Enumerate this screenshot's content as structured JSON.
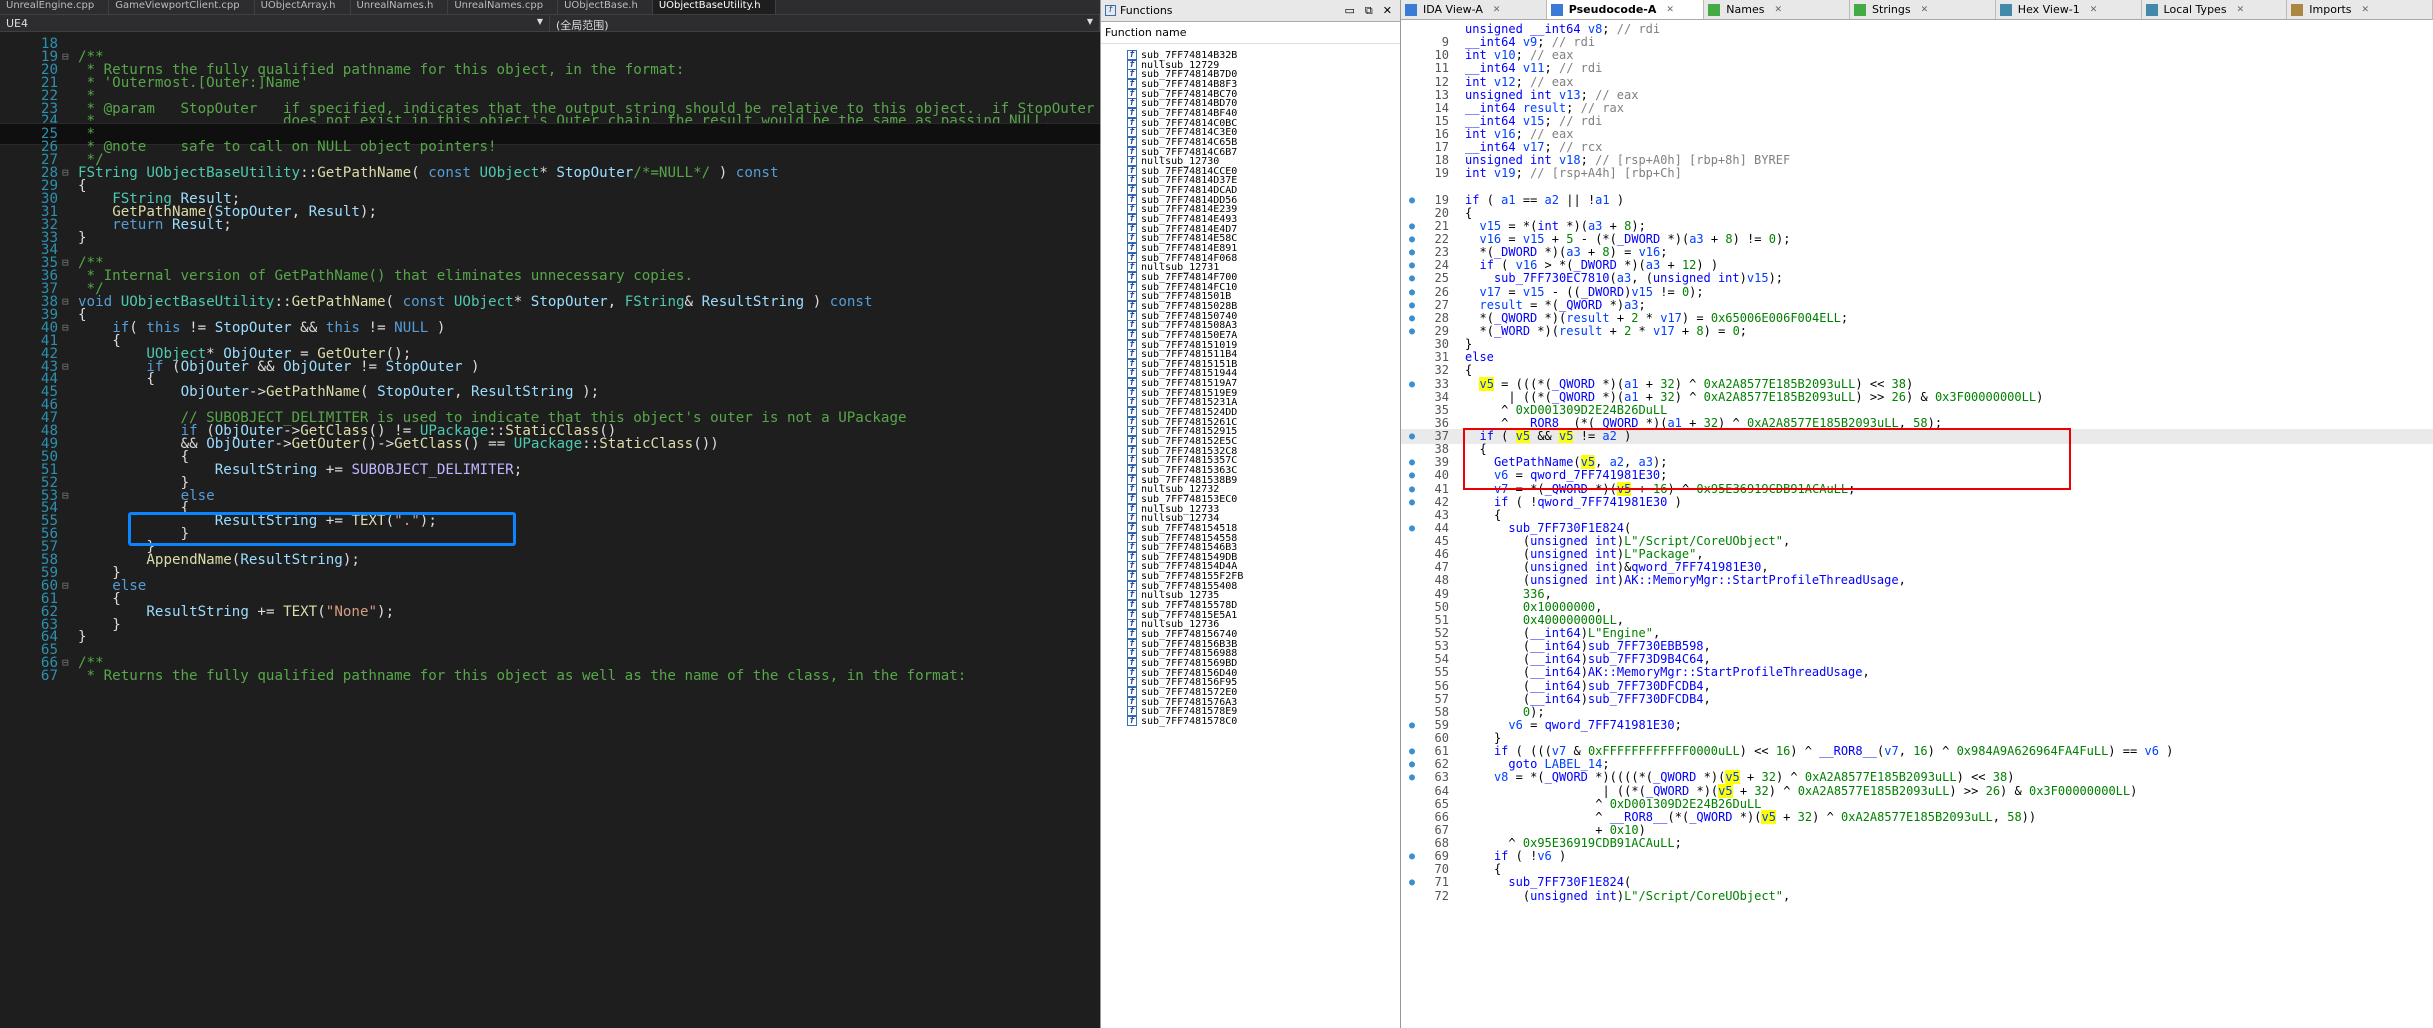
{
  "vs": {
    "tabs": [
      "UnrealEngine.cpp",
      "GameViewportClient.cpp",
      "UObjectArray.h",
      "UnrealNames.h",
      "UnrealNames.cpp",
      "UObjectBase.h",
      "UObjectBaseUtility.h"
    ],
    "nav_left": "UE4",
    "nav_right": "(全局范围)",
    "lines": [
      {
        "n": "18",
        "t": ""
      },
      {
        "n": "19",
        "t": "/**",
        "c": "com",
        "f": "⊟"
      },
      {
        "n": "20",
        "t": " * Returns the fully qualified pathname for this object, in the format:",
        "c": "com"
      },
      {
        "n": "21",
        "t": " * 'Outermost.[Outer:]Name'",
        "c": "com"
      },
      {
        "n": "22",
        "t": " *",
        "c": "com"
      },
      {
        "n": "23",
        "t": " * @param   StopOuter   if specified, indicates that the output string should be relative to this object.  if StopOuter",
        "c": "com"
      },
      {
        "n": "24",
        "t": " *                      does not exist in this object's Outer chain, the result would be the same as passing NULL.",
        "c": "com"
      },
      {
        "n": "25",
        "t": " *",
        "c": "com",
        "cur": true
      },
      {
        "n": "26",
        "t": " * @note    safe to call on NULL object pointers!",
        "c": "com"
      },
      {
        "n": "27",
        "t": " */",
        "c": "com"
      },
      {
        "n": "28",
        "t": "FString UObjectBaseUtility::GetPathName( const UObject* StopOuter/*=NULL*/ ) const",
        "c": "sig1",
        "f": "⊟"
      },
      {
        "n": "29",
        "t": "{"
      },
      {
        "n": "30",
        "t": "    FString Result;",
        "c": "decl"
      },
      {
        "n": "31",
        "t": "    GetPathName(StopOuter, Result);",
        "c": "call"
      },
      {
        "n": "32",
        "t": "    return Result;",
        "c": "ret"
      },
      {
        "n": "33",
        "t": "}"
      },
      {
        "n": "34",
        "t": ""
      },
      {
        "n": "35",
        "t": "/**",
        "c": "com",
        "f": "⊟"
      },
      {
        "n": "36",
        "t": " * Internal version of GetPathName() that eliminates unnecessary copies.",
        "c": "com"
      },
      {
        "n": "37",
        "t": " */",
        "c": "com"
      },
      {
        "n": "38",
        "t": "void UObjectBaseUtility::GetPathName( const UObject* StopOuter, FString& ResultString ) const",
        "c": "sig2",
        "f": "⊟"
      },
      {
        "n": "39",
        "t": "{"
      },
      {
        "n": "40",
        "t": "    if( this != StopOuter && this != NULL )",
        "c": "if",
        "f": "⊟"
      },
      {
        "n": "41",
        "t": "    {"
      },
      {
        "n": "42",
        "t": "        UObject* ObjOuter = GetOuter();",
        "c": "decl2"
      },
      {
        "n": "43",
        "t": "        if (ObjOuter && ObjOuter != StopOuter )",
        "c": "plain",
        "f": "⊟"
      },
      {
        "n": "44",
        "t": "        {"
      },
      {
        "n": "45",
        "t": "            ObjOuter->GetPathName( StopOuter, ResultString );",
        "c": "plain"
      },
      {
        "n": "46",
        "t": ""
      },
      {
        "n": "47",
        "t": "            // SUBOBJECT_DELIMITER is used to indicate that this object's outer is not a UPackage",
        "c": "com"
      },
      {
        "n": "48",
        "t": "            if (ObjOuter->GetClass() != UPackage::StaticClass()",
        "c": "plain"
      },
      {
        "n": "49",
        "t": "            && ObjOuter->GetOuter()->GetClass() == UPackage::StaticClass())",
        "c": "plain"
      },
      {
        "n": "50",
        "t": "            {"
      },
      {
        "n": "51",
        "t": "                ResultString += SUBOBJECT_DELIMITER;",
        "c": "plain"
      },
      {
        "n": "52",
        "t": "            }"
      },
      {
        "n": "53",
        "t": "            else",
        "c": "kwline",
        "f": "⊟"
      },
      {
        "n": "54",
        "t": "            {"
      },
      {
        "n": "55",
        "t": "                ResultString += TEXT(\".\");",
        "c": "plain"
      },
      {
        "n": "56",
        "t": "            }"
      },
      {
        "n": "57",
        "t": "        }"
      },
      {
        "n": "58",
        "t": "        AppendName(ResultString);",
        "c": "plain"
      },
      {
        "n": "59",
        "t": "    }"
      },
      {
        "n": "60",
        "t": "    else",
        "c": "kwline",
        "f": "⊟"
      },
      {
        "n": "61",
        "t": "    {"
      },
      {
        "n": "62",
        "t": "        ResultString += TEXT(\"None\");",
        "c": "plain"
      },
      {
        "n": "63",
        "t": "    }"
      },
      {
        "n": "64",
        "t": "}"
      },
      {
        "n": "65",
        "t": ""
      },
      {
        "n": "66",
        "t": "/**",
        "c": "com",
        "f": "⊟"
      },
      {
        "n": "67",
        "t": " * Returns the fully qualified pathname for this object as well as the name of the class, in the format:",
        "c": "com"
      }
    ]
  },
  "functions": {
    "title": "Functions",
    "column": "Function name",
    "items": [
      "sub_7FF74814B32B",
      "nullsub_12729",
      "sub_7FF74814B7D0",
      "sub_7FF74814B8F3",
      "sub_7FF74814BC70",
      "sub_7FF74814BD70",
      "sub_7FF74814BF40",
      "sub_7FF74814C0BC",
      "sub_7FF74814C3E0",
      "sub_7FF74814C65B",
      "sub_7FF74814C6B7",
      "nullsub_12730",
      "sub_7FF74814CCE0",
      "sub_7FF74814D37E",
      "sub_7FF74814DCAD",
      "sub_7FF74814DD56",
      "sub_7FF74814E239",
      "sub_7FF74814E493",
      "sub_7FF74814E4D7",
      "sub_7FF74814E58C",
      "sub_7FF74814E891",
      "sub_7FF74814F068",
      "nullsub_12731",
      "sub_7FF74814F700",
      "sub_7FF74814FC10",
      "sub_7FF7481501B",
      "sub_7FF74815028B",
      "sub_7FF748150740",
      "sub_7FF7481508A3",
      "sub_7FF748150E7A",
      "sub_7FF748151019",
      "sub_7FF7481511B4",
      "sub_7FF74815151B",
      "sub_7FF748151944",
      "sub_7FF7481519A7",
      "sub_7FF7481519E9",
      "sub_7FF74815231A",
      "sub_7FF7481524DD",
      "sub_7FF74815261C",
      "sub_7FF748152915",
      "sub_7FF748152E5C",
      "sub_7FF7481532C8",
      "sub_7FF74815357C",
      "sub_7FF74815363C",
      "sub_7FF7481538B9",
      "nullsub_12732",
      "sub_7FF748153EC0",
      "nullsub_12733",
      "nullsub_12734",
      "sub_7FF748154518",
      "sub_7FF748154558",
      "sub_7FF7481546B3",
      "sub_7FF7481549DB",
      "sub_7FF748154D4A",
      "sub_7FF748155F2FB",
      "sub_7FF748155408",
      "nullsub_12735",
      "sub_7FF74815578D",
      "sub_7FF74815E5A1",
      "nullsub_12736",
      "sub_7FF748156740",
      "sub_7FF748156B3B",
      "sub_7FF748156988",
      "sub_7FF7481569BD",
      "sub_7FF748156D40",
      "sub_7FF748156F95",
      "sub_7FF7481572E0",
      "sub_7FF7481576A3",
      "sub_7FF7481578E9",
      "sub_7FF7481578C0"
    ]
  },
  "ida": {
    "tabs": [
      {
        "label": "IDA View-A",
        "active": false
      },
      {
        "label": "Pseudocode-A",
        "active": true
      },
      {
        "label": "Names",
        "active": false
      },
      {
        "label": "Strings",
        "active": false
      },
      {
        "label": "Hex View-1",
        "active": false
      },
      {
        "label": "Local Types",
        "active": false
      },
      {
        "label": "Imports",
        "active": false
      }
    ],
    "lines": [
      {
        "n": "",
        "t": "unsigned __int64 v8; // rdi"
      },
      {
        "n": "9",
        "t": "__int64 v9; // rdi"
      },
      {
        "n": "10",
        "t": "int v10; // eax"
      },
      {
        "n": "11",
        "t": "__int64 v11; // rdi"
      },
      {
        "n": "12",
        "t": "int v12; // eax"
      },
      {
        "n": "13",
        "t": "unsigned int v13; // eax"
      },
      {
        "n": "14",
        "t": "__int64 result; // rax"
      },
      {
        "n": "15",
        "t": "__int64 v15; // rdi"
      },
      {
        "n": "16",
        "t": "int v16; // eax"
      },
      {
        "n": "17",
        "t": "__int64 v17; // rcx"
      },
      {
        "n": "18",
        "t": "unsigned int v18; // [rsp+A0h] [rbp+8h] BYREF"
      },
      {
        "n": "19",
        "t": "int v19; // [rsp+A4h] [rbp+Ch]"
      },
      {
        "n": "",
        "t": ""
      },
      {
        "n": "19",
        "t": "if ( a1 == a2 || !a1 )",
        "bp": true
      },
      {
        "n": "20",
        "t": "{"
      },
      {
        "n": "21",
        "t": "  v15 = *(int *)(a3 + 8);",
        "bp": true
      },
      {
        "n": "22",
        "t": "  v16 = v15 + 5 - (*(_DWORD *)(a3 + 8) != 0);",
        "bp": true
      },
      {
        "n": "23",
        "t": "  *(_DWORD *)(a3 + 8) = v16;",
        "bp": true
      },
      {
        "n": "24",
        "t": "  if ( v16 > *(_DWORD *)(a3 + 12) )",
        "bp": true
      },
      {
        "n": "25",
        "t": "    sub_7FF730EC7810(a3, (unsigned int)v15);",
        "bp": true
      },
      {
        "n": "26",
        "t": "  v17 = v15 - ((_DWORD)v15 != 0);",
        "bp": true
      },
      {
        "n": "27",
        "t": "  result = *(_QWORD *)a3;",
        "bp": true
      },
      {
        "n": "28",
        "t": "  *(_QWORD *)(result + 2 * v17) = 0x65006E006F004ELL;",
        "bp": true
      },
      {
        "n": "29",
        "t": "  *(_WORD *)(result + 2 * v17 + 8) = 0;",
        "bp": true
      },
      {
        "n": "30",
        "t": "}"
      },
      {
        "n": "31",
        "t": "else"
      },
      {
        "n": "32",
        "t": "{"
      },
      {
        "n": "33",
        "t": "  v5 = (((*(_QWORD *)(a1 + 32) ^ 0xA2A8577E185B2093uLL) << 38)",
        "bp": true,
        "y": "v5"
      },
      {
        "n": "34",
        "t": "      | ((*(_QWORD *)(a1 + 32) ^ 0xA2A8577E185B2093uLL) >> 26) & 0x3F00000000LL)"
      },
      {
        "n": "35",
        "t": "     ^ 0xD001309D2E24B26DuLL"
      },
      {
        "n": "36",
        "t": "     ^ __ROR8__(*(_QWORD *)(a1 + 32) ^ 0xA2A8577E185B2093uLL, 58);"
      },
      {
        "n": "37",
        "t": "  if ( v5 && v5 != a2 )",
        "bp": true,
        "hl": true
      },
      {
        "n": "38",
        "t": "  {"
      },
      {
        "n": "39",
        "t": "    GetPathName(v5, a2, a3);",
        "bp": true
      },
      {
        "n": "40",
        "t": "    v6 = qword_7FF741981E30;",
        "bp": true
      },
      {
        "n": "41",
        "t": "    v7 = *(_QWORD *)(v5 + 16) ^ 0x95E36919CDB91ACAuLL;",
        "bp": true
      },
      {
        "n": "42",
        "t": "    if ( !qword_7FF741981E30 )",
        "bp": true
      },
      {
        "n": "43",
        "t": "    {"
      },
      {
        "n": "44",
        "t": "      sub_7FF730F1E824(",
        "bp": true
      },
      {
        "n": "45",
        "t": "        (unsigned int)L\"/Script/CoreUObject\","
      },
      {
        "n": "46",
        "t": "        (unsigned int)L\"Package\","
      },
      {
        "n": "47",
        "t": "        (unsigned int)&qword_7FF741981E30,"
      },
      {
        "n": "48",
        "t": "        (unsigned int)AK::MemoryMgr::StartProfileThreadUsage,"
      },
      {
        "n": "49",
        "t": "        336,"
      },
      {
        "n": "50",
        "t": "        0x10000000,"
      },
      {
        "n": "51",
        "t": "        0x400000000LL,"
      },
      {
        "n": "52",
        "t": "        (__int64)L\"Engine\","
      },
      {
        "n": "53",
        "t": "        (__int64)sub_7FF730EBB598,"
      },
      {
        "n": "54",
        "t": "        (__int64)sub_7FF73D9B4C64,"
      },
      {
        "n": "55",
        "t": "        (__int64)AK::MemoryMgr::StartProfileThreadUsage,"
      },
      {
        "n": "56",
        "t": "        (__int64)sub_7FF730DFCDB4,"
      },
      {
        "n": "57",
        "t": "        (__int64)sub_7FF730DFCDB4,"
      },
      {
        "n": "58",
        "t": "        0);"
      },
      {
        "n": "59",
        "t": "      v6 = qword_7FF741981E30;",
        "bp": true
      },
      {
        "n": "60",
        "t": "    }"
      },
      {
        "n": "61",
        "t": "    if ( (((v7 & 0xFFFFFFFFFFFF0000uLL) << 16) ^ __ROR8__(v7, 16) ^ 0x984A9A626964FA4FuLL) == v6 )",
        "bp": true
      },
      {
        "n": "62",
        "t": "      goto LABEL_14;",
        "bp": true
      },
      {
        "n": "63",
        "t": "    v8 = *(_QWORD *)((((*(_QWORD *)(v5 + 32) ^ 0xA2A8577E185B2093uLL) << 38)",
        "bp": true
      },
      {
        "n": "64",
        "t": "                   | ((*(_QWORD *)(v5 + 32) ^ 0xA2A8577E185B2093uLL) >> 26) & 0x3F00000000LL)"
      },
      {
        "n": "65",
        "t": "                  ^ 0xD001309D2E24B26DuLL"
      },
      {
        "n": "66",
        "t": "                  ^ __ROR8__(*(_QWORD *)(v5 + 32) ^ 0xA2A8577E185B2093uLL, 58))"
      },
      {
        "n": "67",
        "t": "                  + 0x10)"
      },
      {
        "n": "68",
        "t": "      ^ 0x95E36919CDB91ACAuLL;"
      },
      {
        "n": "69",
        "t": "    if ( !v6 )",
        "bp": true
      },
      {
        "n": "70",
        "t": "    {"
      },
      {
        "n": "71",
        "t": "      sub_7FF730F1E824(",
        "bp": true
      },
      {
        "n": "72",
        "t": "        (unsigned int)L\"/Script/CoreUObject\","
      }
    ]
  }
}
